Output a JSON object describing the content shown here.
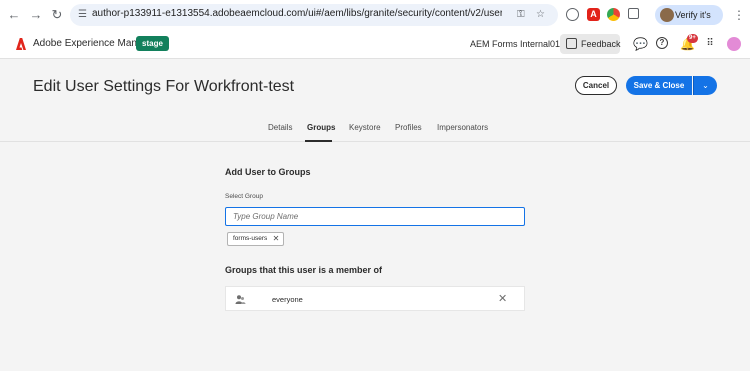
{
  "browser": {
    "url": "author-p133911-e1313554.adobeaemcloud.com/ui#/aem/libs/granite/security/content/v2/usereditor.html/home...",
    "verify_label": "Verify it's you",
    "icons": [
      "back-icon",
      "forward-icon",
      "reload-icon",
      "site-info-icon",
      "password-key-icon",
      "bookmark-star-icon"
    ]
  },
  "shell": {
    "app_title": "Adobe Experience Manager",
    "env_badge": "stage",
    "org_name": "AEM Forms Internal01",
    "feedback_label": "Feedback",
    "notification_count": "9+",
    "colors": {
      "badge": "#12805c",
      "accent": "#1473e6",
      "notification": "#d7373f"
    }
  },
  "header": {
    "title": "Edit User Settings For Workfront-test",
    "cancel_label": "Cancel",
    "save_label": "Save & Close"
  },
  "tabs": [
    {
      "label": "Details",
      "active": false
    },
    {
      "label": "Groups",
      "active": true
    },
    {
      "label": "Keystore",
      "active": false
    },
    {
      "label": "Profiles",
      "active": false
    },
    {
      "label": "Impersonators",
      "active": false
    }
  ],
  "form": {
    "add_heading": "Add User to Groups",
    "select_label": "Select Group",
    "input_placeholder": "Type Group Name",
    "selected_tag": "forms-users",
    "members_heading": "Groups that this user is a member of",
    "members": [
      {
        "name": "everyone"
      }
    ]
  }
}
